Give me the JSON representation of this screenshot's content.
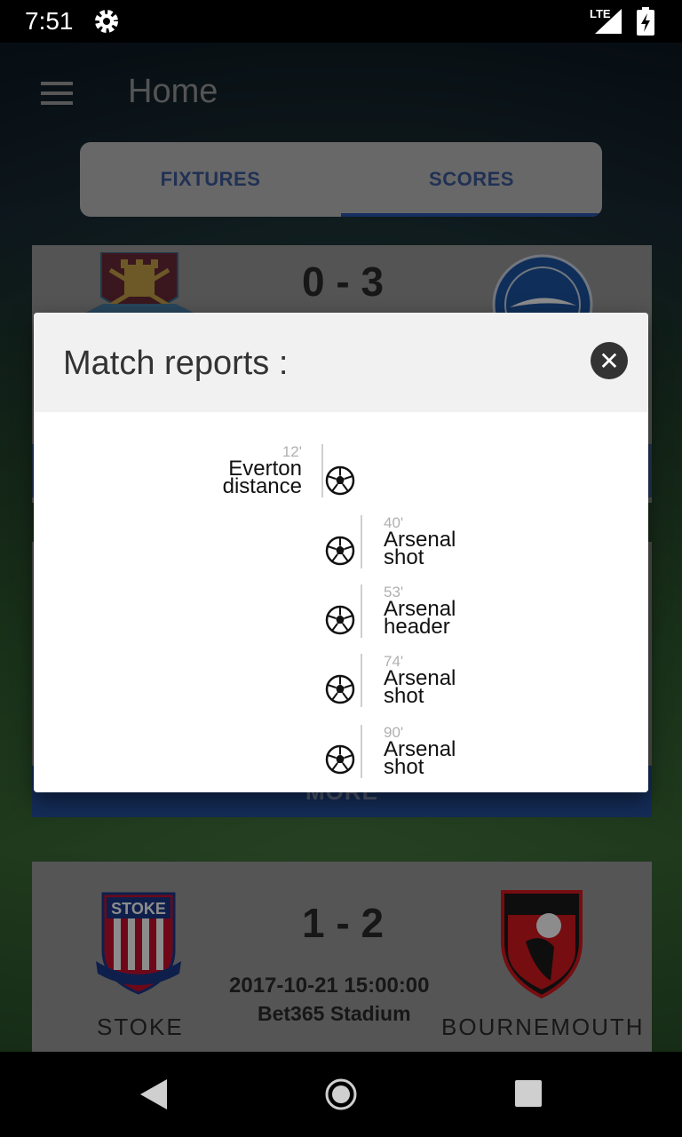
{
  "status_bar": {
    "time": "7:51",
    "network": "LTE"
  },
  "app_bar": {
    "title": "Home"
  },
  "tabs": [
    {
      "label": "FIXTURES",
      "selected": false
    },
    {
      "label": "SCORES",
      "selected": true
    }
  ],
  "matches": [
    {
      "score": "0 - 3"
    },
    {
      "more_label": "MORE"
    },
    {
      "score": "1 - 2",
      "home": "STOKE",
      "away": "BOURNEMOUTH",
      "date": "2017-10-21 15:00:00",
      "venue": "Bet365 Stadium"
    }
  ],
  "dialog": {
    "title": "Match reports :",
    "events": [
      {
        "minute": "12'",
        "team": "Everton",
        "type": "distance"
      },
      {
        "minute": "40'",
        "team": "Arsenal",
        "type": "shot"
      },
      {
        "minute": "53'",
        "team": "Arsenal",
        "type": "header"
      },
      {
        "minute": "74'",
        "team": "Arsenal",
        "type": "shot"
      },
      {
        "minute": "90'",
        "team": "Arsenal",
        "type": "shot"
      }
    ]
  }
}
